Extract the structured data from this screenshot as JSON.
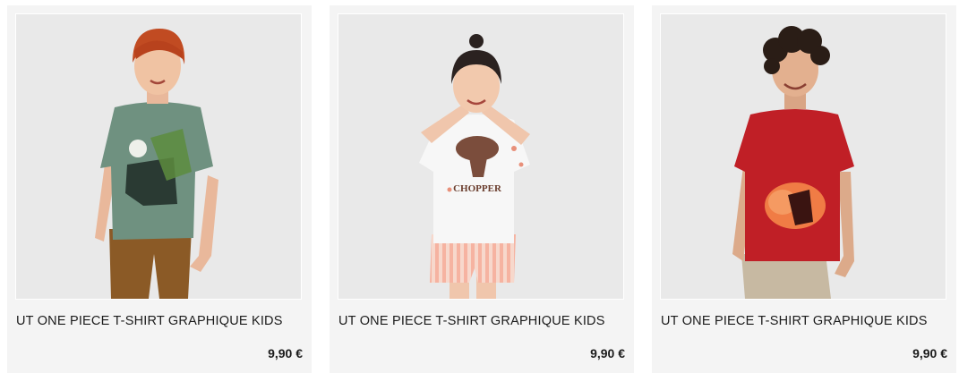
{
  "products": [
    {
      "name": "UT ONE PIECE T-SHIRT GRAPHIQUE KIDS",
      "price": "9,90 €",
      "shirt_color": "#6f9180",
      "graphic_text": ""
    },
    {
      "name": "UT ONE PIECE T-SHIRT GRAPHIQUE KIDS",
      "price": "9,90 €",
      "shirt_color": "#f7f7f7",
      "graphic_text": "CHOPPER"
    },
    {
      "name": "UT ONE PIECE T-SHIRT GRAPHIQUE KIDS",
      "price": "9,90 €",
      "shirt_color": "#c01f26",
      "graphic_text": ""
    }
  ],
  "colors": {
    "card_bg": "#f4f4f4",
    "photo_bg": "#e9e9e9",
    "text": "#1b1b1b"
  }
}
